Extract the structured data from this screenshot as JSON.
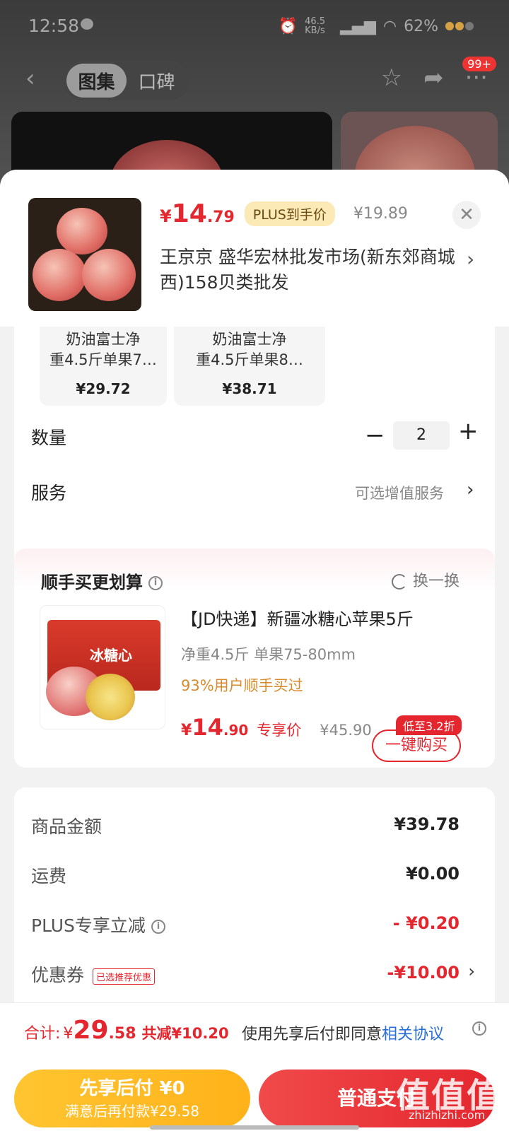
{
  "status_bar": {
    "time": "12:58",
    "net_speed": "46.5 KB/s",
    "battery": "62%"
  },
  "nav": {
    "tabs": [
      {
        "label": "图集",
        "active": true
      },
      {
        "label": "口碑",
        "active": false
      }
    ],
    "badge": "99+"
  },
  "sheet": {
    "price": {
      "currency": "¥",
      "integer": "14",
      "decimal": ".79"
    },
    "plus_tag": "PLUS到手价",
    "original_price": "¥19.89",
    "store": "王京京  盛华宏林批发市场(新东郊商城西)158贝类批发",
    "variants": [
      {
        "name_line1": "奶油富士净",
        "name_line2": "重4.5斤单果7…",
        "price": "¥29.72"
      },
      {
        "name_line1": "奶油富士净",
        "name_line2": "重4.5斤单果8…",
        "price": "¥38.71"
      }
    ],
    "quantity_label": "数量",
    "quantity_minus": "−",
    "quantity_value": "2",
    "quantity_plus": "+",
    "service_label": "服务",
    "service_hint": "可选增值服务"
  },
  "recommend": {
    "title": "顺手买更划算",
    "swap_label": "换一换",
    "product_name": "【JD快递】新疆冰糖心苹果5斤",
    "image_text": "冰糖心",
    "spec": "净重4.5斤 单果75-80mm",
    "buyers_pct": "93%用户顺手买过",
    "price": {
      "currency": "¥",
      "integer": "14",
      "decimal": ".90"
    },
    "exclusive_label": "专享价",
    "original_price": "¥45.90",
    "discount_tag": "低至3.2折",
    "buy_button": "一键购买"
  },
  "totals": {
    "rows": [
      {
        "label": "商品金额",
        "value": "¥39.78",
        "red": false
      },
      {
        "label": "运费",
        "value": "¥0.00",
        "red": false
      },
      {
        "label": "PLUS专享立减",
        "value": "- ¥0.20",
        "red": true
      },
      {
        "label": "优惠券",
        "value": "-¥10.00",
        "red": true
      }
    ],
    "coupon_tag": "已选推荐优惠"
  },
  "bottom": {
    "sum_label": "合计:",
    "sum_currency": "¥",
    "sum_integer": "29",
    "sum_decimal": ".58",
    "sum_save": "共减¥10.20",
    "agree_text": "使用先享后付即同意",
    "agree_link": "相关协议",
    "later_line1": "先享后付 ¥0",
    "later_line2": "满意后再付款¥29.58",
    "pay_label": "普通支付"
  },
  "watermark": {
    "text": "值值值",
    "url": "zhizhizhi.com"
  },
  "colors": {
    "price_red": "#e4262e",
    "plus_gold": "#fbe9b6",
    "later_yellow": "#ffc531"
  }
}
